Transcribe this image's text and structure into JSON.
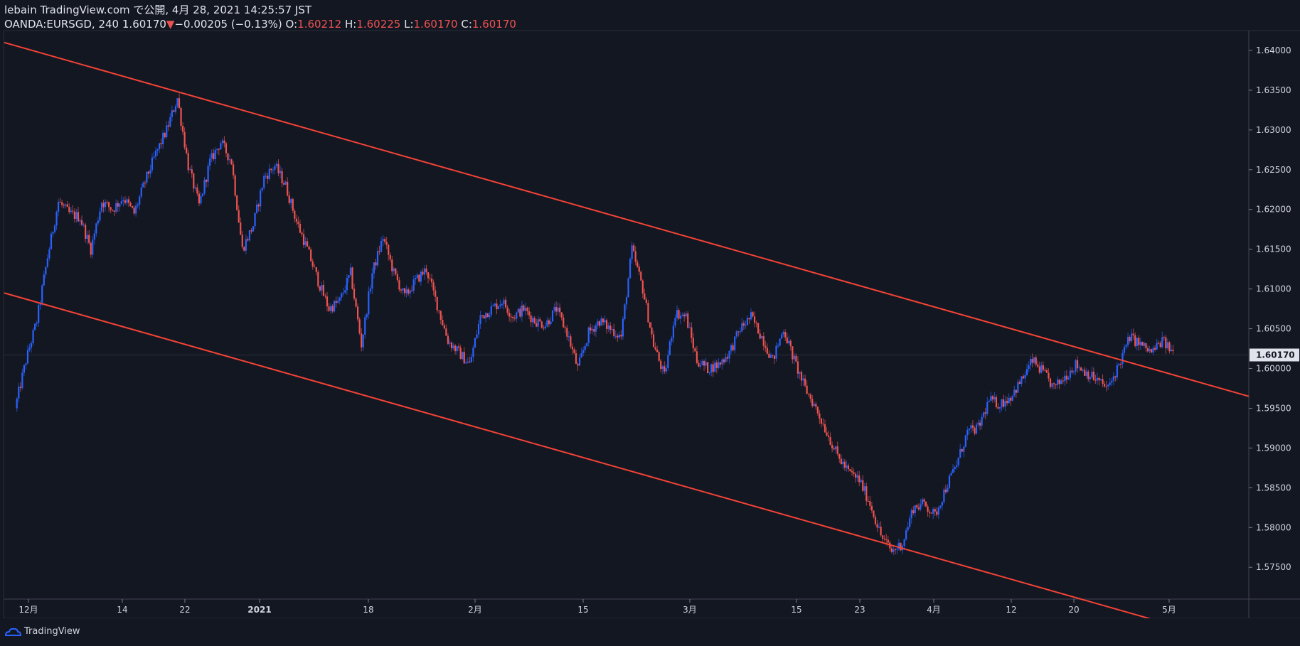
{
  "header": {
    "line1": "lebain TradingView.com で公開, 4月 28, 2021 14:25:57 JST",
    "symbol": "OANDA:EURSGD, 240",
    "last": "1.60170",
    "arrow": "▼",
    "change": "−0.00205 (−0.13%)",
    "o_label": "O:",
    "o_value": "1.60212",
    "h_label": "H:",
    "h_value": "1.60225",
    "l_label": "L:",
    "l_value": "1.60170",
    "c_label": "C:",
    "c_value": "1.60170"
  },
  "footer": {
    "brand": "TradingView"
  },
  "colors": {
    "background": "#131722",
    "up": "#2962ff",
    "down": "#ef5350",
    "trendline": "#f44336",
    "axis_text": "#d1d4dc",
    "last_label_bg": "#e0e3eb"
  },
  "chart_data": {
    "type": "candlestick",
    "symbol": "OANDA:EURSGD",
    "timeframe_minutes": 240,
    "y_axis": {
      "ticks": [
        "1.57500",
        "1.58000",
        "1.58500",
        "1.59000",
        "1.59500",
        "1.60000",
        "1.60500",
        "1.61000",
        "1.61500",
        "1.62000",
        "1.62500",
        "1.63000",
        "1.63500",
        "1.64000"
      ],
      "last_price_label": "1.60170"
    },
    "x_axis": {
      "tick_labels": [
        "12月",
        "14",
        "22",
        "2021",
        "18",
        "2月",
        "15",
        "3月",
        "15",
        "23",
        "4月",
        "12",
        "20",
        "5月"
      ]
    },
    "close_path": [
      {
        "x": 0.0,
        "y": 1.595
      },
      {
        "x": 1.0,
        "y": 1.601
      },
      {
        "x": 2.0,
        "y": 1.606
      },
      {
        "x": 3.0,
        "y": 1.614
      },
      {
        "x": 4.0,
        "y": 1.621
      },
      {
        "x": 5.0,
        "y": 1.6195
      },
      {
        "x": 6.0,
        "y": 1.619
      },
      {
        "x": 7.0,
        "y": 1.615
      },
      {
        "x": 8.0,
        "y": 1.621
      },
      {
        "x": 9.0,
        "y": 1.62
      },
      {
        "x": 10.0,
        "y": 1.6215
      },
      {
        "x": 11.0,
        "y": 1.6195
      },
      {
        "x": 12.0,
        "y": 1.6235
      },
      {
        "x": 13.0,
        "y": 1.627
      },
      {
        "x": 14.0,
        "y": 1.63
      },
      {
        "x": 15.0,
        "y": 1.634
      },
      {
        "x": 16.0,
        "y": 1.6255
      },
      {
        "x": 17.0,
        "y": 1.6205
      },
      {
        "x": 18.0,
        "y": 1.626
      },
      {
        "x": 19.0,
        "y": 1.6285
      },
      {
        "x": 20.0,
        "y": 1.626
      },
      {
        "x": 21.0,
        "y": 1.615
      },
      {
        "x": 22.0,
        "y": 1.618
      },
      {
        "x": 23.0,
        "y": 1.624
      },
      {
        "x": 24.0,
        "y": 1.6255
      },
      {
        "x": 25.0,
        "y": 1.623
      },
      {
        "x": 26.0,
        "y": 1.6185
      },
      {
        "x": 27.0,
        "y": 1.615
      },
      {
        "x": 28.0,
        "y": 1.611
      },
      {
        "x": 29.0,
        "y": 1.6075
      },
      {
        "x": 30.0,
        "y": 1.6085
      },
      {
        "x": 31.0,
        "y": 1.612
      },
      {
        "x": 32.0,
        "y": 1.603
      },
      {
        "x": 33.0,
        "y": 1.612
      },
      {
        "x": 34.0,
        "y": 1.6165
      },
      {
        "x": 35.0,
        "y": 1.612
      },
      {
        "x": 36.0,
        "y": 1.609
      },
      {
        "x": 37.0,
        "y": 1.611
      },
      {
        "x": 38.0,
        "y": 1.6125
      },
      {
        "x": 39.0,
        "y": 1.608
      },
      {
        "x": 40.0,
        "y": 1.6035
      },
      {
        "x": 41.0,
        "y": 1.602
      },
      {
        "x": 42.0,
        "y": 1.6005
      },
      {
        "x": 43.0,
        "y": 1.6065
      },
      {
        "x": 44.0,
        "y": 1.6075
      },
      {
        "x": 45.0,
        "y": 1.6085
      },
      {
        "x": 46.0,
        "y": 1.6065
      },
      {
        "x": 47.0,
        "y": 1.6075
      },
      {
        "x": 48.0,
        "y": 1.606
      },
      {
        "x": 49.0,
        "y": 1.6055
      },
      {
        "x": 50.0,
        "y": 1.6075
      },
      {
        "x": 51.0,
        "y": 1.6045
      },
      {
        "x": 52.0,
        "y": 1.6
      },
      {
        "x": 53.0,
        "y": 1.6045
      },
      {
        "x": 54.0,
        "y": 1.606
      },
      {
        "x": 55.0,
        "y": 1.605
      },
      {
        "x": 56.0,
        "y": 1.604
      },
      {
        "x": 57.0,
        "y": 1.615
      },
      {
        "x": 58.0,
        "y": 1.61
      },
      {
        "x": 59.0,
        "y": 1.603
      },
      {
        "x": 60.0,
        "y": 1.599
      },
      {
        "x": 61.0,
        "y": 1.607
      },
      {
        "x": 62.0,
        "y": 1.6065
      },
      {
        "x": 63.0,
        "y": 1.601
      },
      {
        "x": 64.0,
        "y": 1.6
      },
      {
        "x": 65.0,
        "y": 1.6005
      },
      {
        "x": 66.0,
        "y": 1.602
      },
      {
        "x": 67.0,
        "y": 1.605
      },
      {
        "x": 68.0,
        "y": 1.6065
      },
      {
        "x": 69.0,
        "y": 1.604
      },
      {
        "x": 70.0,
        "y": 1.601
      },
      {
        "x": 71.0,
        "y": 1.605
      },
      {
        "x": 72.0,
        "y": 1.601
      },
      {
        "x": 73.0,
        "y": 1.5975
      },
      {
        "x": 74.0,
        "y": 1.595
      },
      {
        "x": 75.0,
        "y": 1.592
      },
      {
        "x": 76.0,
        "y": 1.589
      },
      {
        "x": 77.0,
        "y": 1.587
      },
      {
        "x": 78.0,
        "y": 1.586
      },
      {
        "x": 79.0,
        "y": 1.583
      },
      {
        "x": 80.0,
        "y": 1.579
      },
      {
        "x": 81.0,
        "y": 1.577
      },
      {
        "x": 82.0,
        "y": 1.578
      },
      {
        "x": 83.0,
        "y": 1.5825
      },
      {
        "x": 84.0,
        "y": 1.583
      },
      {
        "x": 85.0,
        "y": 1.5815
      },
      {
        "x": 86.0,
        "y": 1.585
      },
      {
        "x": 87.0,
        "y": 1.588
      },
      {
        "x": 88.0,
        "y": 1.592
      },
      {
        "x": 89.0,
        "y": 1.5925
      },
      {
        "x": 90.0,
        "y": 1.596
      },
      {
        "x": 91.0,
        "y": 1.5955
      },
      {
        "x": 92.0,
        "y": 1.5965
      },
      {
        "x": 93.0,
        "y": 1.5985
      },
      {
        "x": 94.0,
        "y": 1.601
      },
      {
        "x": 95.0,
        "y": 1.5995
      },
      {
        "x": 96.0,
        "y": 1.5975
      },
      {
        "x": 97.0,
        "y": 1.599
      },
      {
        "x": 98.0,
        "y": 1.6005
      },
      {
        "x": 99.0,
        "y": 1.5995
      },
      {
        "x": 100.0,
        "y": 1.5985
      },
      {
        "x": 101.0,
        "y": 1.5975
      },
      {
        "x": 102.0,
        "y": 1.6005
      },
      {
        "x": 103.0,
        "y": 1.604
      },
      {
        "x": 104.0,
        "y": 1.603
      },
      {
        "x": 105.0,
        "y": 1.602
      },
      {
        "x": 106.0,
        "y": 1.6035
      },
      {
        "x": 107.0,
        "y": 1.602
      }
    ],
    "trendlines": [
      {
        "name": "upper",
        "from": {
          "x": -1.0,
          "y": 1.641
        },
        "to": {
          "x": 114.0,
          "y": 1.5965
        }
      },
      {
        "name": "lower",
        "from": {
          "x": -1.0,
          "y": 1.6095
        },
        "to": {
          "x": 114.0,
          "y": 1.565
        }
      }
    ],
    "last_price": 1.6017
  }
}
